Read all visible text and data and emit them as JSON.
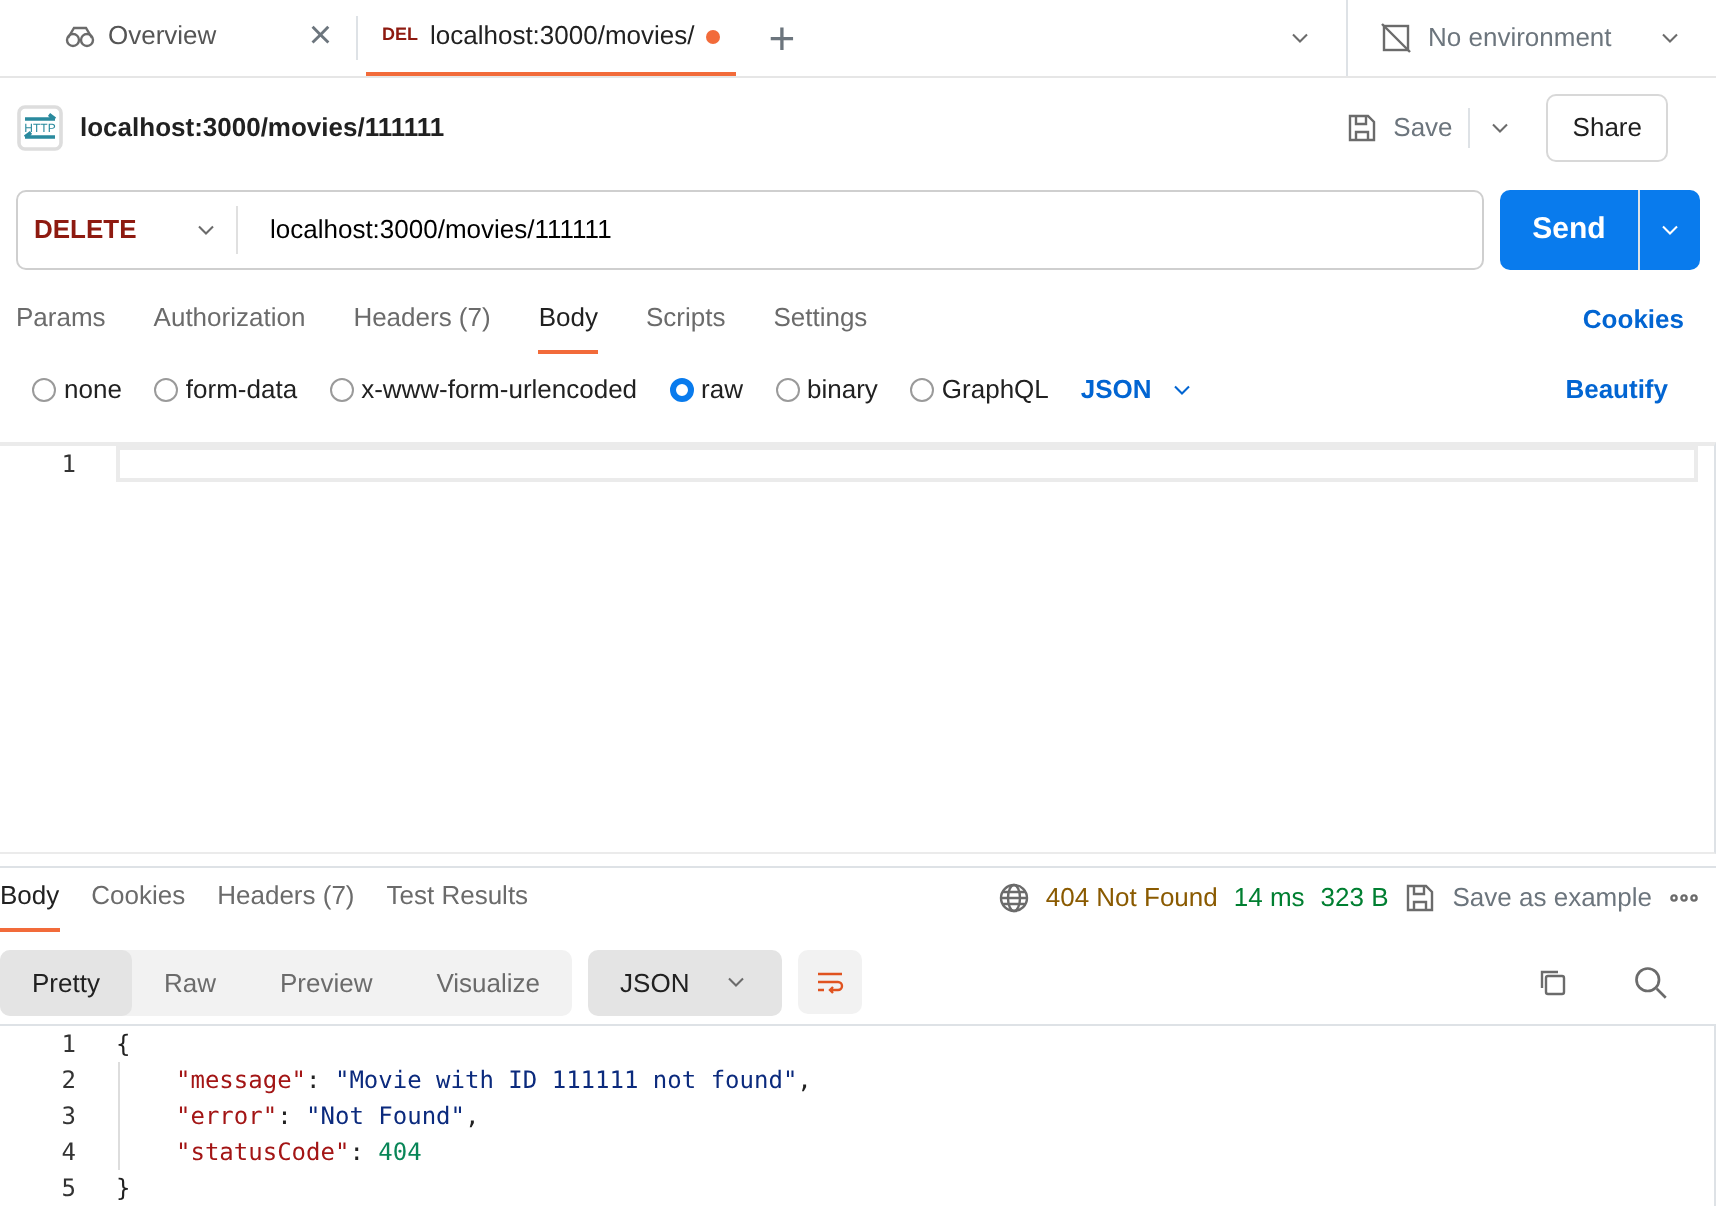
{
  "tabs": [
    {
      "kind": "overview",
      "label": "Overview",
      "selected": false,
      "close": "×"
    },
    {
      "kind": "request",
      "method": "DEL",
      "label": "localhost:3000/movies/",
      "selected": true,
      "unsaved": true
    }
  ],
  "add_tab": "+",
  "environment": {
    "label": "No environment"
  },
  "request": {
    "icon_label": "HTTP",
    "name": "localhost:3000/movies/111111",
    "save": "Save",
    "share": "Share",
    "method": "DELETE",
    "url": "localhost:3000/movies/111111",
    "send": "Send"
  },
  "request_tabs": [
    {
      "label": "Params",
      "selected": false
    },
    {
      "label": "Authorization",
      "selected": false
    },
    {
      "label": "Headers (7)",
      "selected": false
    },
    {
      "label": "Body",
      "selected": true
    },
    {
      "label": "Scripts",
      "selected": false
    },
    {
      "label": "Settings",
      "selected": false
    }
  ],
  "cookies_link": "Cookies",
  "body_types": [
    {
      "label": "none",
      "selected": false
    },
    {
      "label": "form-data",
      "selected": false
    },
    {
      "label": "x-www-form-urlencoded",
      "selected": false
    },
    {
      "label": "raw",
      "selected": true
    },
    {
      "label": "binary",
      "selected": false
    },
    {
      "label": "GraphQL",
      "selected": false
    }
  ],
  "body_format": "JSON",
  "beautify": "Beautify",
  "editor": {
    "line_numbers": [
      "1"
    ]
  },
  "response_tabs": [
    {
      "label": "Body",
      "selected": true
    },
    {
      "label": "Cookies",
      "selected": false
    },
    {
      "label": "Headers (7)",
      "selected": false
    },
    {
      "label": "Test Results",
      "selected": false
    }
  ],
  "response_meta": {
    "status": "404 Not Found",
    "time": "14 ms",
    "size": "323 B",
    "save_example": "Save as example"
  },
  "view_modes": [
    {
      "label": "Pretty",
      "selected": true
    },
    {
      "label": "Raw",
      "selected": false
    },
    {
      "label": "Preview",
      "selected": false
    },
    {
      "label": "Visualize",
      "selected": false
    }
  ],
  "response_format": "JSON",
  "response_code": {
    "line_numbers": [
      "1",
      "2",
      "3",
      "4",
      "5"
    ],
    "lines": [
      {
        "tokens": [
          {
            "kind": "punct",
            "text": "{"
          }
        ],
        "children": [
          {
            "tokens": [
              {
                "kind": "key",
                "text": "\"message\""
              },
              {
                "kind": "punct",
                "text": ": "
              },
              {
                "kind": "string",
                "text": "\"Movie with ID 111111 not found\""
              },
              {
                "kind": "punct",
                "text": ","
              }
            ]
          },
          {
            "tokens": [
              {
                "kind": "key",
                "text": "\"error\""
              },
              {
                "kind": "punct",
                "text": ": "
              },
              {
                "kind": "string",
                "text": "\"Not Found\""
              },
              {
                "kind": "punct",
                "text": ","
              }
            ]
          },
          {
            "tokens": [
              {
                "kind": "key",
                "text": "\"statusCode\""
              },
              {
                "kind": "punct",
                "text": ": "
              },
              {
                "kind": "number",
                "text": "404"
              }
            ]
          }
        ]
      },
      {
        "tokens": [
          {
            "kind": "punct",
            "text": "}"
          }
        ]
      }
    ]
  }
}
